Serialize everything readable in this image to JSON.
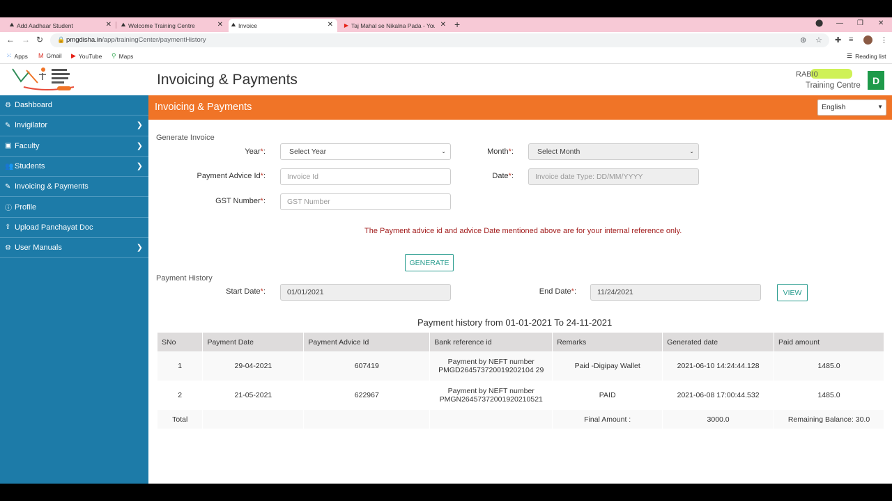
{
  "browser": {
    "tabs": [
      {
        "title": "Add Aadhaar Student",
        "icon": "pmgdisha-icon"
      },
      {
        "title": "Welcome Training Centre",
        "icon": "pmgdisha-icon"
      },
      {
        "title": "Invoice",
        "icon": "pmgdisha-icon"
      },
      {
        "title": "Taj Mahal se Nikalna Pada - YouT",
        "icon": "youtube-icon"
      }
    ],
    "url_domain": "pmgdisha.in",
    "url_path": "/app/trainingCenter/paymentHistory",
    "bookmarks": [
      {
        "label": "Apps"
      },
      {
        "label": "Gmail"
      },
      {
        "label": "YouTube"
      },
      {
        "label": "Maps"
      }
    ],
    "reading_list": "Reading list"
  },
  "header": {
    "title": "Invoicing & Payments",
    "user_name": "RABI0",
    "user_role": "Training Centre",
    "user_initial": "D"
  },
  "sidebar": {
    "items": [
      {
        "label": "Dashboard",
        "icon": "dashboard-icon",
        "glyph": "⚙",
        "has_children": false
      },
      {
        "label": "Invigilator",
        "icon": "invigilator-icon",
        "glyph": "✎",
        "has_children": true
      },
      {
        "label": "Faculty",
        "icon": "faculty-icon",
        "glyph": "▣",
        "has_children": true
      },
      {
        "label": "Students",
        "icon": "students-icon",
        "glyph": "👥",
        "has_children": true
      },
      {
        "label": "Invoicing & Payments",
        "icon": "invoice-icon",
        "glyph": "✎",
        "has_children": false
      },
      {
        "label": "Profile",
        "icon": "profile-icon",
        "glyph": "ⓘ",
        "has_children": false
      },
      {
        "label": "Upload Panchayat Doc",
        "icon": "upload-icon",
        "glyph": "⇪",
        "has_children": false
      },
      {
        "label": "User Manuals",
        "icon": "manuals-icon",
        "glyph": "⚙",
        "has_children": true
      }
    ]
  },
  "banner": {
    "title": "Invoicing & Payments",
    "language": "English"
  },
  "generate_invoice": {
    "section_title": "Generate Invoice",
    "year_label": "Year",
    "year_value": "Select Year",
    "month_label": "Month",
    "month_value": "Select Month",
    "payment_advice_label": "Payment Advice Id",
    "payment_advice_placeholder": "Invoice Id",
    "date_label": "Date",
    "date_placeholder": "Invoice date Type: DD/MM/YYYY",
    "gst_label": "GST Number",
    "gst_placeholder": "GST Number",
    "required_mark": "*",
    "label_suffix": ":",
    "notice": "The Payment advice id and advice Date mentioned above are for your internal reference only.",
    "generate_button": "GENERATE"
  },
  "payment_history": {
    "section_title": "Payment History",
    "start_label": "Start Date",
    "start_value": "01/01/2021",
    "end_label": "End Date",
    "end_value": "11/24/2021",
    "view_button": "VIEW",
    "caption": "Payment history from 01-01-2021 To 24-11-2021",
    "columns": [
      "SNo",
      "Payment Date",
      "Payment Advice Id",
      "Bank reference id",
      "Remarks",
      "Generated date",
      "Paid amount"
    ],
    "rows": [
      {
        "sno": "1",
        "payment_date": "29-04-2021",
        "advice_id": "607419",
        "bank_ref_line1": "Payment by NEFT number",
        "bank_ref_line2": "PMGD264573720019202104 29",
        "remarks": "Paid -Digipay Wallet",
        "generated": "2021-06-10 14:24:44.128",
        "amount": "1485.0"
      },
      {
        "sno": "2",
        "payment_date": "21-05-2021",
        "advice_id": "622967",
        "bank_ref_line1": "Payment by NEFT number",
        "bank_ref_line2": "PMGN26457372001920210521",
        "remarks": "PAID",
        "generated": "2021-06-08 17:00:44.532",
        "amount": "1485.0"
      }
    ],
    "total_label": "Total",
    "final_amount_label": "Final Amount :",
    "final_amount": "3000.0",
    "remaining_balance": "Remaining Balance: 30.0"
  }
}
